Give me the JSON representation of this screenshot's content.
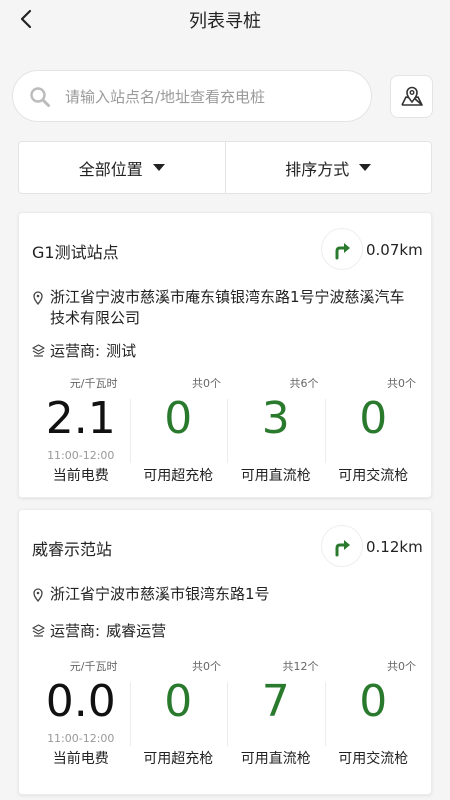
{
  "header": {
    "title": "列表寻桩"
  },
  "search": {
    "placeholder": "请输入站点名/地址查看充电桩"
  },
  "filters": {
    "location": "全部位置",
    "sort": "排序方式"
  },
  "stations": [
    {
      "name": "G1测试站点",
      "distance": "0.07km",
      "address": "浙江省宁波市慈溪市庵东镇银湾东路1号宁波慈溪汽车技术有限公司",
      "operator_label": "运营商:",
      "operator": "测试",
      "fee_unit": "元/千瓦时",
      "fee": "2.1",
      "fee_hours": "11:00-12:00",
      "fee_label": "当前电费",
      "super": {
        "total": "共0个",
        "available": "0",
        "label": "可用超充枪"
      },
      "dc": {
        "total": "共6个",
        "available": "3",
        "label": "可用直流枪"
      },
      "ac": {
        "total": "共0个",
        "available": "0",
        "label": "可用交流枪"
      }
    },
    {
      "name": "威睿示范站",
      "distance": "0.12km",
      "address": "浙江省宁波市慈溪市银湾东路1号",
      "operator_label": "运营商:",
      "operator": "威睿运营",
      "fee_unit": "元/千瓦时",
      "fee": "0.0",
      "fee_hours": "11:00-12:00",
      "fee_label": "当前电费",
      "super": {
        "total": "共0个",
        "available": "0",
        "label": "可用超充枪"
      },
      "dc": {
        "total": "共12个",
        "available": "7",
        "label": "可用直流枪"
      },
      "ac": {
        "total": "共0个",
        "available": "0",
        "label": "可用交流枪"
      }
    }
  ],
  "colors": {
    "accent": "#2a7a2e",
    "background": "#f5f5f5"
  }
}
